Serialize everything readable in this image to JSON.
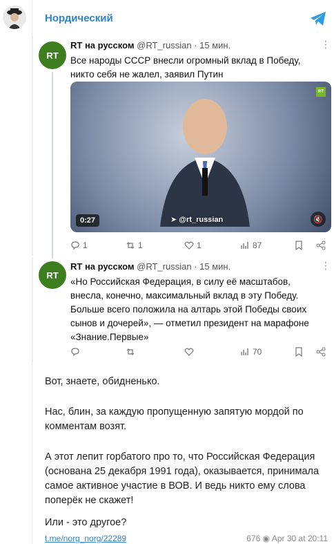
{
  "channel": {
    "name": "Нордический"
  },
  "tweets": [
    {
      "author": "RT на русском",
      "handle": "@RT_russian",
      "time": "· 15 мин.",
      "text": "Все народы СССР внесли огромный вклад в Победу, никто себя не жалел, заявил Путин",
      "video": {
        "duration": "0:27",
        "watermark": "@rt_russian"
      },
      "stats": {
        "replies": "1",
        "retweets": "1",
        "likes": "1",
        "views": "87"
      }
    },
    {
      "author": "RT на русском",
      "handle": "@RT_russian",
      "time": "· 15 мин.",
      "text": "«Но Российская Федерация, в силу её масштабов, внесла, конечно, максимальный вклад в эту Победу. Больше всего положила на алтарь этой Победы своих сынов и дочерей», — отметил президент на марафоне «Знание.Первые»",
      "stats": {
        "replies": "",
        "retweets": "",
        "likes": "",
        "views": "70"
      }
    }
  ],
  "post": {
    "p1": "Вот, знаете, обидненько.",
    "p2": "Нас, блин, за каждую пропущенную запятую мордой по комментам возят.",
    "p3": "А этот лепит горбатого про то, что Российская Федерация (основана 25 декабря 1991 года), оказывается, принимала самое активное участие в ВОВ. И ведь никто ему слова поперёк не скажет!",
    "p4": "Или - это другое?"
  },
  "footer": {
    "link": "t.me/norg_norg/22289",
    "views": "676",
    "date": "Apr 30 at 20:11"
  },
  "colors": {
    "accent": "#2f83c9",
    "rt_green": "#3d7f1f"
  }
}
